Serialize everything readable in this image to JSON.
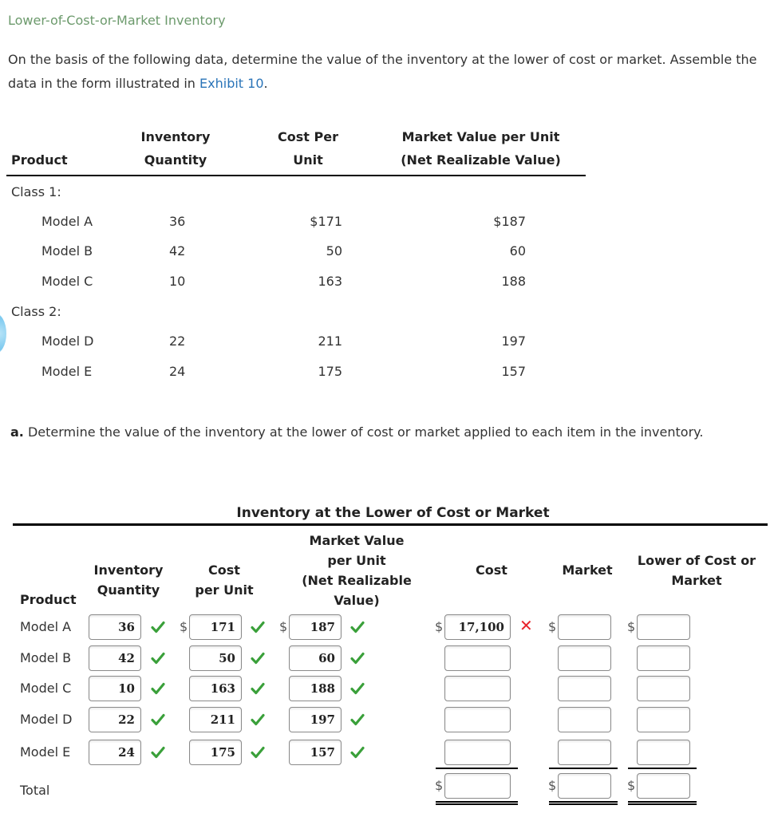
{
  "title": "Lower-of-Cost-or-Market Inventory",
  "intro": {
    "text_before": "On the basis of the following data, determine the value of the inventory at the lower of cost or market. Assemble the data in the form illustrated in ",
    "link": "Exhibit 10",
    "text_after": "."
  },
  "data_table": {
    "headers": {
      "product": "Product",
      "qty_line1": "Inventory",
      "qty_line2": "Quantity",
      "cost_line1": "Cost Per",
      "cost_line2": "Unit",
      "mkt_line1": "Market Value per Unit",
      "mkt_line2": "(Net Realizable Value)"
    },
    "class1_label": "Class 1:",
    "class2_label": "Class 2:",
    "rows": [
      {
        "product": "Model A",
        "qty": "36",
        "cost": "$171",
        "market": "$187"
      },
      {
        "product": "Model B",
        "qty": "42",
        "cost": "50",
        "market": "60"
      },
      {
        "product": "Model C",
        "qty": "10",
        "cost": "163",
        "market": "188"
      },
      {
        "product": "Model D",
        "qty": "22",
        "cost": "211",
        "market": "197"
      },
      {
        "product": "Model E",
        "qty": "24",
        "cost": "175",
        "market": "157"
      }
    ]
  },
  "question": {
    "label": "a.",
    "text": " Determine the value of the inventory at the lower of cost or market applied to each item in the inventory."
  },
  "answer_table": {
    "title": "Inventory at the Lower of Cost or Market",
    "headers": {
      "product": "Product",
      "qty_line1": "Inventory",
      "qty_line2": "Quantity",
      "cost_line1": "Cost",
      "cost_line2": "per Unit",
      "mkt_line1": "Market Value",
      "mkt_line2": "per Unit",
      "mkt_line3": "(Net Realizable",
      "mkt_line4": "Value)",
      "cost": "Cost",
      "market": "Market",
      "lcm_line1": "Lower of Cost or",
      "lcm_line2": "Market"
    },
    "currency_symbol": "$",
    "rows": [
      {
        "product": "Model A",
        "qty": "36",
        "qty_status": "correct",
        "cost_per_unit": "171",
        "cpu_status": "correct",
        "market_per_unit": "187",
        "mpu_status": "correct",
        "cost": "17,100",
        "cost_status": "incorrect",
        "market": "",
        "lcm": ""
      },
      {
        "product": "Model B",
        "qty": "42",
        "qty_status": "correct",
        "cost_per_unit": "50",
        "cpu_status": "correct",
        "market_per_unit": "60",
        "mpu_status": "correct",
        "cost": "",
        "market": "",
        "lcm": ""
      },
      {
        "product": "Model C",
        "qty": "10",
        "qty_status": "correct",
        "cost_per_unit": "163",
        "cpu_status": "correct",
        "market_per_unit": "188",
        "mpu_status": "correct",
        "cost": "",
        "market": "",
        "lcm": ""
      },
      {
        "product": "Model D",
        "qty": "22",
        "qty_status": "correct",
        "cost_per_unit": "211",
        "cpu_status": "correct",
        "market_per_unit": "197",
        "mpu_status": "correct",
        "cost": "",
        "market": "",
        "lcm": ""
      },
      {
        "product": "Model E",
        "qty": "24",
        "qty_status": "correct",
        "cost_per_unit": "175",
        "cpu_status": "correct",
        "market_per_unit": "157",
        "mpu_status": "correct",
        "cost": "",
        "market": "",
        "lcm": ""
      }
    ],
    "total": {
      "label": "Total",
      "cost": "",
      "market": "",
      "lcm": ""
    }
  },
  "colors": {
    "title_green": "#6c9a6c",
    "link_blue": "#2a74b8",
    "check_green": "#3aa03a",
    "x_red": "#e8232b"
  }
}
